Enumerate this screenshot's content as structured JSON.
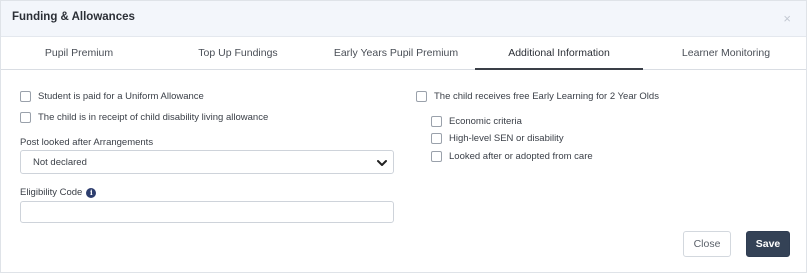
{
  "dialog": {
    "title": "Funding & Allowances",
    "close_icon": "×"
  },
  "tabs": [
    {
      "label": "Pupil Premium",
      "active": false
    },
    {
      "label": "Top Up Fundings",
      "active": false
    },
    {
      "label": "Early Years Pupil Premium",
      "active": false
    },
    {
      "label": "Additional Information",
      "active": true
    },
    {
      "label": "Learner Monitoring",
      "active": false
    }
  ],
  "left": {
    "uniform_allowance": {
      "label": "Student is paid for a Uniform Allowance",
      "checked": false
    },
    "disability_allowance": {
      "label": "The child is in receipt of child disability living allowance",
      "checked": false
    },
    "post_lac": {
      "label": "Post looked after Arrangements",
      "value": "Not declared"
    },
    "eligibility_code": {
      "label": "Eligibility Code",
      "value": "",
      "info_icon": "info-icon"
    }
  },
  "right": {
    "early_learning": {
      "label": "The child receives free Early Learning for 2 Year Olds",
      "checked": false
    },
    "criteria": [
      {
        "label": "Economic criteria",
        "checked": false
      },
      {
        "label": "High-level SEN or disability",
        "checked": false
      },
      {
        "label": "Looked after or adopted from care",
        "checked": false
      }
    ]
  },
  "footer": {
    "close_label": "Close",
    "save_label": "Save"
  },
  "colors": {
    "header_bg": "#f3f6fb",
    "save_bg": "#344256",
    "active_tab_border": "#3a3f47"
  }
}
